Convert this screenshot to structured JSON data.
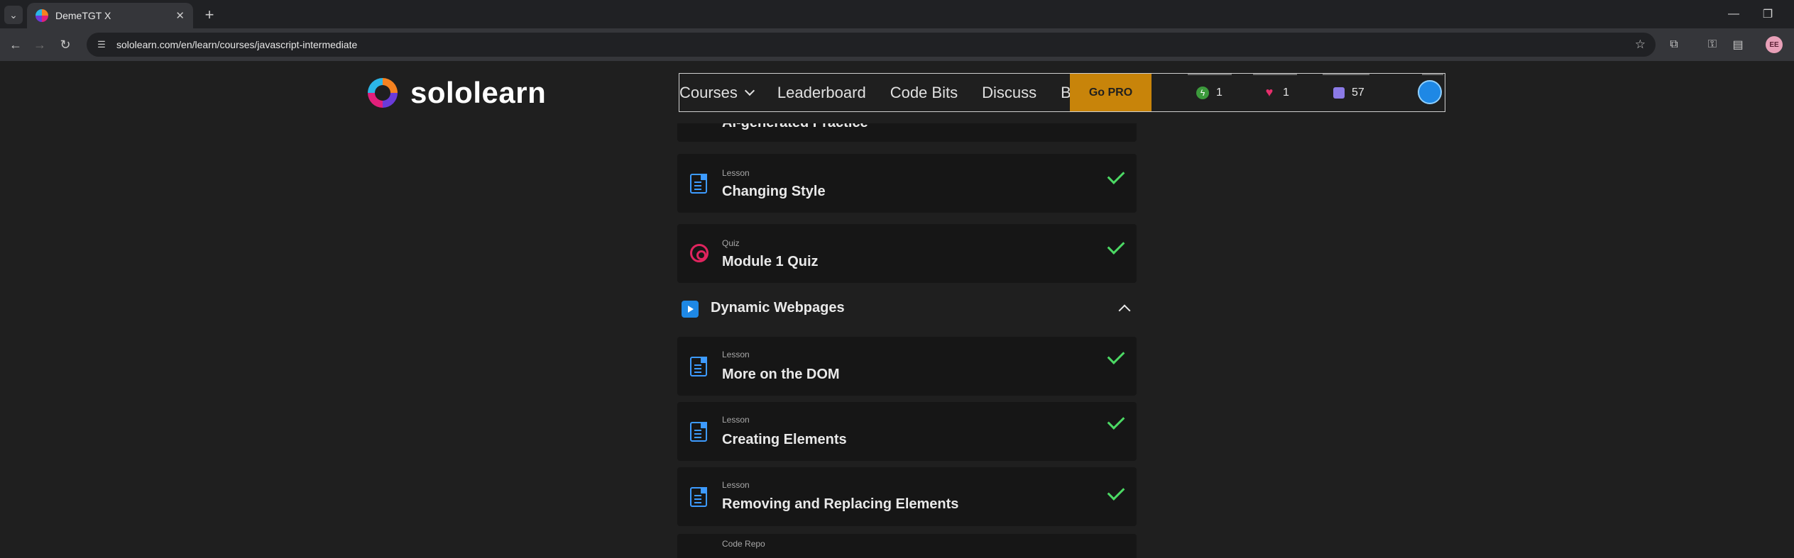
{
  "browser": {
    "tab_title": "DemeTGT X",
    "url": "sololearn.com/en/learn/courses/javascript-intermediate",
    "profile_initials": "ЕЕ"
  },
  "site": {
    "logo_text": "sololearn",
    "nav": {
      "courses": "Courses",
      "leaderboard": "Leaderboard",
      "code_bits": "Code Bits",
      "discuss": "Discuss",
      "blog": "Blog",
      "go_pro": "Go PRO"
    },
    "stats": {
      "streak": "1",
      "hearts": "1",
      "bits": "57"
    },
    "colors": {
      "go_pro_bg": "#c8840a",
      "accent_blue": "#3d9bff",
      "check_green": "#4cd964",
      "quiz_red": "#e0245e"
    }
  },
  "course": {
    "partial_item_title": "AI-generated Practice",
    "items_top": [
      {
        "type": "Lesson",
        "title": "Changing Style",
        "done": true,
        "icon": "lesson-icon"
      },
      {
        "type": "Quiz",
        "title": "Module 1 Quiz",
        "done": true,
        "icon": "quiz-icon"
      }
    ],
    "module": {
      "title": "Dynamic Webpages",
      "icon": "play-icon"
    },
    "items_module": [
      {
        "type": "Lesson",
        "title": "More on the DOM",
        "done": true,
        "icon": "lesson-icon"
      },
      {
        "type": "Lesson",
        "title": "Creating Elements",
        "done": true,
        "icon": "lesson-icon"
      },
      {
        "type": "Lesson",
        "title": "Removing and Replacing Elements",
        "done": true,
        "icon": "lesson-icon"
      },
      {
        "type": "Code Repo",
        "title": "",
        "done": false,
        "icon": "code-repo-icon"
      }
    ]
  }
}
